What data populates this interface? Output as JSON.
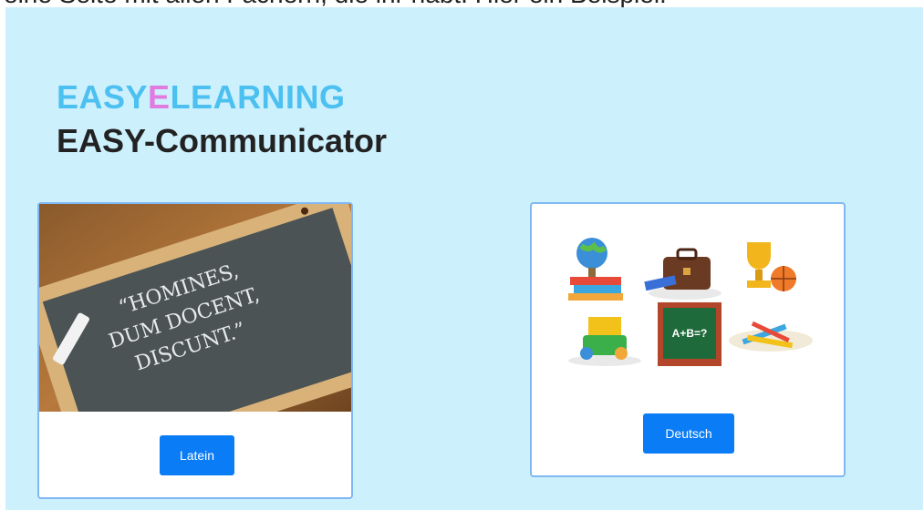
{
  "caption": "eine Seite mit allen Fächern, die ihr habt. Hier ein Beispiel:",
  "brand": {
    "part1": "EASY",
    "accent": "E",
    "part2": "LEARNING"
  },
  "subtitle": "EASY-Communicator",
  "cards": [
    {
      "button_label": "Latein",
      "chalk_lines": [
        "“HOMINES,",
        "DUM DOCENT,",
        "DISCUNT.”"
      ]
    },
    {
      "button_label": "Deutsch",
      "board_text": "A+B=?"
    }
  ],
  "colors": {
    "background": "#cdf0fd",
    "brand_blue": "#4cc0f0",
    "brand_pink": "#e07be0",
    "button": "#0a7cf5",
    "card_border": "#7fb8f2"
  },
  "icons": [
    "globe-icon",
    "books-icon",
    "briefcase-icon",
    "trophy-icon",
    "basketball-icon",
    "lunchbox-icon",
    "chalkboard-icon",
    "pencils-icon"
  ]
}
